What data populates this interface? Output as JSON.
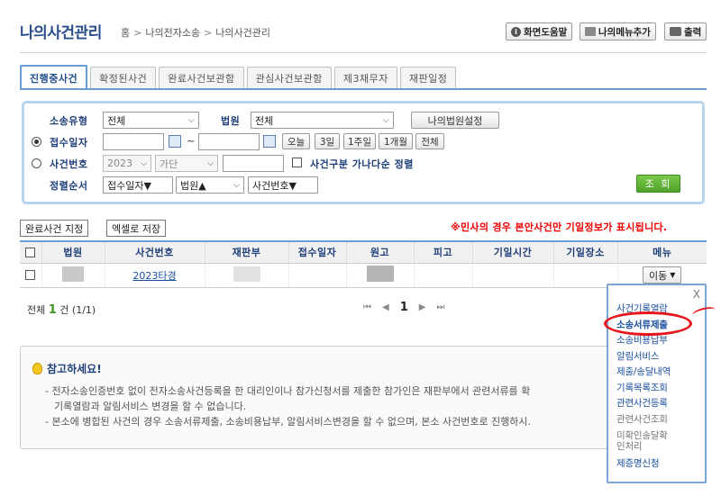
{
  "header": {
    "title": "나의사건관리",
    "breadcrumb": [
      "홈",
      "나의전자소송",
      "나의사건관리"
    ],
    "buttons": {
      "help": "화면도움말",
      "add_menu": "나의메뉴추가",
      "print": "출력"
    }
  },
  "tabs": [
    {
      "label": "진행중사건",
      "active": true
    },
    {
      "label": "확정된사건",
      "active": false
    },
    {
      "label": "완료사건보관함",
      "active": false
    },
    {
      "label": "관심사건보관함",
      "active": false
    },
    {
      "label": "제3채무자",
      "active": false
    },
    {
      "label": "재판일정",
      "active": false
    }
  ],
  "search": {
    "case_type_label": "소송유형",
    "case_type_value": "전체",
    "court_label": "법원",
    "court_value": "전체",
    "my_court_button": "나의법원설정",
    "date_label": "접수일자",
    "date_tilde": "~",
    "date_buttons": [
      "오늘",
      "3일",
      "1주일",
      "1개월",
      "전체"
    ],
    "case_no_label": "사건번호",
    "year_value": "2023",
    "case_code_value": "가단",
    "sort_check_label": "사건구분 가나다순 정렬",
    "sort_label": "정렬순서",
    "sort1": "접수일자▼",
    "sort2": "법원▲",
    "sort3": "사건번호▼",
    "search_button": "조 회"
  },
  "actions": {
    "complete_button": "완료사건 지정",
    "excel_button": "엑셀로 저장",
    "notice": "※민사의 경우 본안사건만 기일정보가 표시됩니다."
  },
  "table": {
    "headers": [
      "법원",
      "사건번호",
      "재판부",
      "접수일자",
      "원고",
      "피고",
      "기일시간",
      "기일장소",
      "메뉴"
    ],
    "rows": [
      {
        "case_no": "2023타경",
        "menu_button": "이동"
      }
    ]
  },
  "pagination": {
    "total_prefix": "전체",
    "total_count": "1",
    "total_suffix": "건 (1/1)",
    "current_page": "1"
  },
  "notes": {
    "title": "참고하세요!",
    "line1": "- 전자소송인증번호 없이 전자소송사건등록을 한 대리인이나 참가신청서를 제출한 참가인은 재판부에서 관련서류를 확",
    "line2": "기록열람과 알림서비스 변경을 할 수 없습니다.",
    "line3": "- 본소에 병합된 사건의 경우 소송서류제출, 소송비용납부, 알림서비스변경을 할 수 없으며, 본소 사건번호로 진행하시."
  },
  "popup_menu": {
    "close": "X",
    "items": [
      "사건기록열람",
      "소송서류제출",
      "소송비용납부",
      "알림서비스",
      "제출/송달내역",
      "기록목록조회",
      "관련사건등록",
      "관련사건조회",
      "미확인송달확",
      "인처리",
      "제증명신청"
    ]
  },
  "colors": {
    "accent": "#6a9cd6",
    "title": "#2a4e8c",
    "notice": "#e00000",
    "search_button": "#4ea12a",
    "highlight_circle": "#e8151c"
  }
}
